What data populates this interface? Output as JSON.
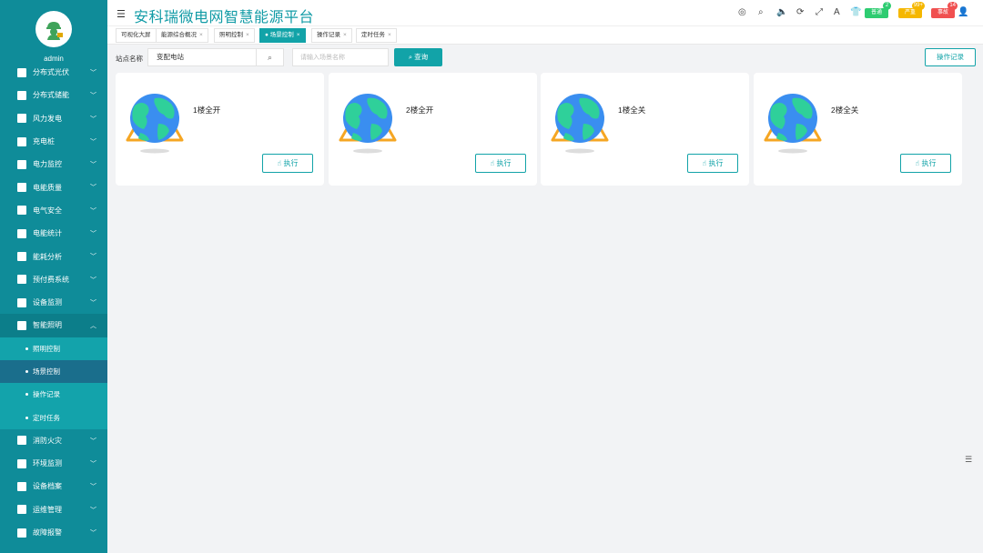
{
  "app": {
    "title": "安科瑞微电网智慧能源平台",
    "user": "admin"
  },
  "header": {
    "badges": [
      {
        "label": "普通",
        "count": "2",
        "color": "#2ecc71"
      },
      {
        "label": "严重",
        "count": "99+",
        "color": "#f5b700"
      },
      {
        "label": "事故",
        "count": "14",
        "color": "#f05050"
      }
    ]
  },
  "sidebar": {
    "items": [
      {
        "label": "分布式光伏"
      },
      {
        "label": "分布式储能"
      },
      {
        "label": "风力发电"
      },
      {
        "label": "充电桩"
      },
      {
        "label": "电力监控"
      },
      {
        "label": "电能质量"
      },
      {
        "label": "电气安全"
      },
      {
        "label": "电能统计"
      },
      {
        "label": "能耗分析"
      },
      {
        "label": "预付费系统"
      },
      {
        "label": "设备监测"
      },
      {
        "label": "智能照明"
      }
    ],
    "sub_items": [
      {
        "label": "照明控制"
      },
      {
        "label": "场景控制"
      },
      {
        "label": "操作记录"
      },
      {
        "label": "定时任务"
      }
    ],
    "items_after": [
      {
        "label": "消防火灾"
      },
      {
        "label": "环境监测"
      },
      {
        "label": "设备档案"
      },
      {
        "label": "运维管理"
      },
      {
        "label": "故障报警"
      }
    ]
  },
  "tabs": [
    {
      "label": "可视化大屏"
    },
    {
      "label": "能源综合概况"
    },
    {
      "label": "照明控制"
    },
    {
      "label": "场景控制"
    },
    {
      "label": "操作记录"
    },
    {
      "label": "定时任务"
    }
  ],
  "search": {
    "station_label": "站点名称",
    "station_value": "变配电站",
    "scene_placeholder": "请输入场景名称",
    "query_label": "查询",
    "oplog_label": "操作记录"
  },
  "cards": [
    {
      "name": "1楼全开",
      "exec_label": "执行"
    },
    {
      "name": "2楼全开",
      "exec_label": "执行"
    },
    {
      "name": "1楼全关",
      "exec_label": "执行"
    },
    {
      "name": "2楼全关",
      "exec_label": "执行"
    }
  ]
}
